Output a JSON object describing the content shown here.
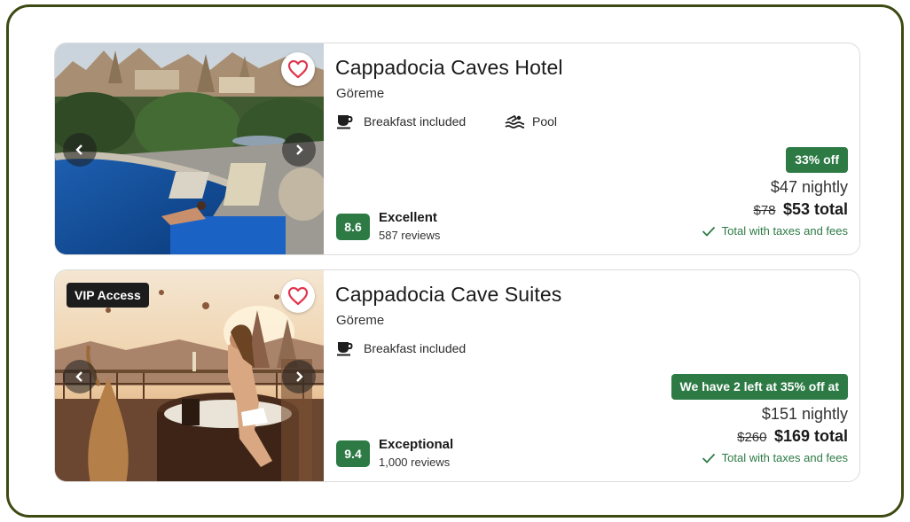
{
  "listings": [
    {
      "name": "Cappadocia Caves Hotel",
      "location": "Göreme",
      "amenities": [
        {
          "label": "Breakfast included",
          "icon": "coffee-cup-icon"
        },
        {
          "label": "Pool",
          "icon": "pool-icon"
        }
      ],
      "badge": "",
      "score": "8.6",
      "rating_label": "Excellent",
      "reviews": "587 reviews",
      "deal": "33% off",
      "nightly": "$47 nightly",
      "old_price": "$78",
      "total": "$53 total",
      "taxes_note": "Total with taxes and fees",
      "favorite_icon": "heart-outline-icon"
    },
    {
      "name": "Cappadocia Cave Suites",
      "location": "Göreme",
      "amenities": [
        {
          "label": "Breakfast included",
          "icon": "coffee-cup-icon"
        }
      ],
      "badge": "VIP Access",
      "score": "9.4",
      "rating_label": "Exceptional",
      "reviews": "1,000 reviews",
      "deal": "We have 2 left at 35% off at",
      "nightly": "$151 nightly",
      "old_price": "$260",
      "total": "$169 total",
      "taxes_note": "Total with taxes and fees",
      "favorite_icon": "heart-outline-icon"
    }
  ],
  "colors": {
    "accent_green": "#2d7a45",
    "frame_border": "#3d4a12",
    "heart": "#e0364e"
  }
}
